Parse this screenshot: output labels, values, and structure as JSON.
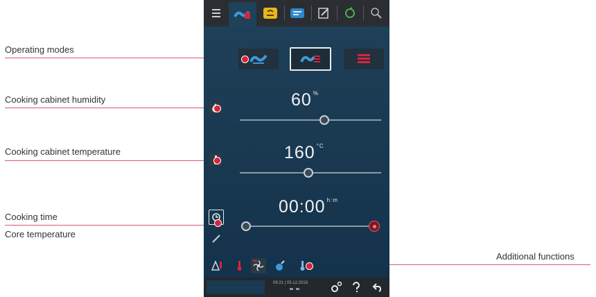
{
  "annotations": {
    "operating_modes": "Operating modes",
    "humidity": "Cooking cabinet humidity",
    "temperature": "Cooking cabinet temperature",
    "cooking_time": "Cooking time",
    "core_temperature": "Core temperature",
    "additional_functions": "Additional functions"
  },
  "screen": {
    "humidity": {
      "value": "60",
      "unit": "%",
      "level": 0.6
    },
    "temperature": {
      "value": "160",
      "unit": "°C",
      "level": 0.45
    },
    "time": {
      "value": "00:00",
      "unit": "h:m",
      "level": 0
    },
    "status": {
      "clock": "09:21 | 05.12.2018"
    }
  },
  "colors": {
    "accent_red": "#d9233c",
    "accent_blue": "#2e86c9",
    "accent_yellow": "#e8b720"
  }
}
